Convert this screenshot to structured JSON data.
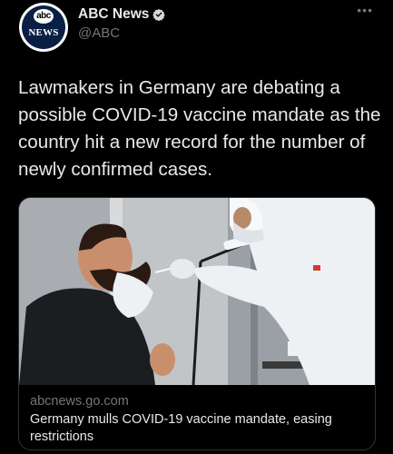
{
  "author": {
    "display_name": "ABC News",
    "handle": "@ABC",
    "avatar_badge": "abc",
    "avatar_word": "NEWS",
    "verified": true
  },
  "tweet": {
    "text": "Lawmakers in Germany are debating a possible COVID-19 vaccine mandate as the country hit a new record for the number of newly confirmed cases."
  },
  "card": {
    "domain": "abcnews.go.com",
    "title": "Germany mulls COVID-19 vaccine mandate, easing restrictions"
  },
  "icons": {
    "more": "more-options-icon",
    "verified": "verified-badge-icon"
  },
  "colors": {
    "background": "#000000",
    "primary_text": "#e7e9ea",
    "secondary_text": "#71767b",
    "border": "#2f3336",
    "verified_badge": "#d9d9d9"
  }
}
